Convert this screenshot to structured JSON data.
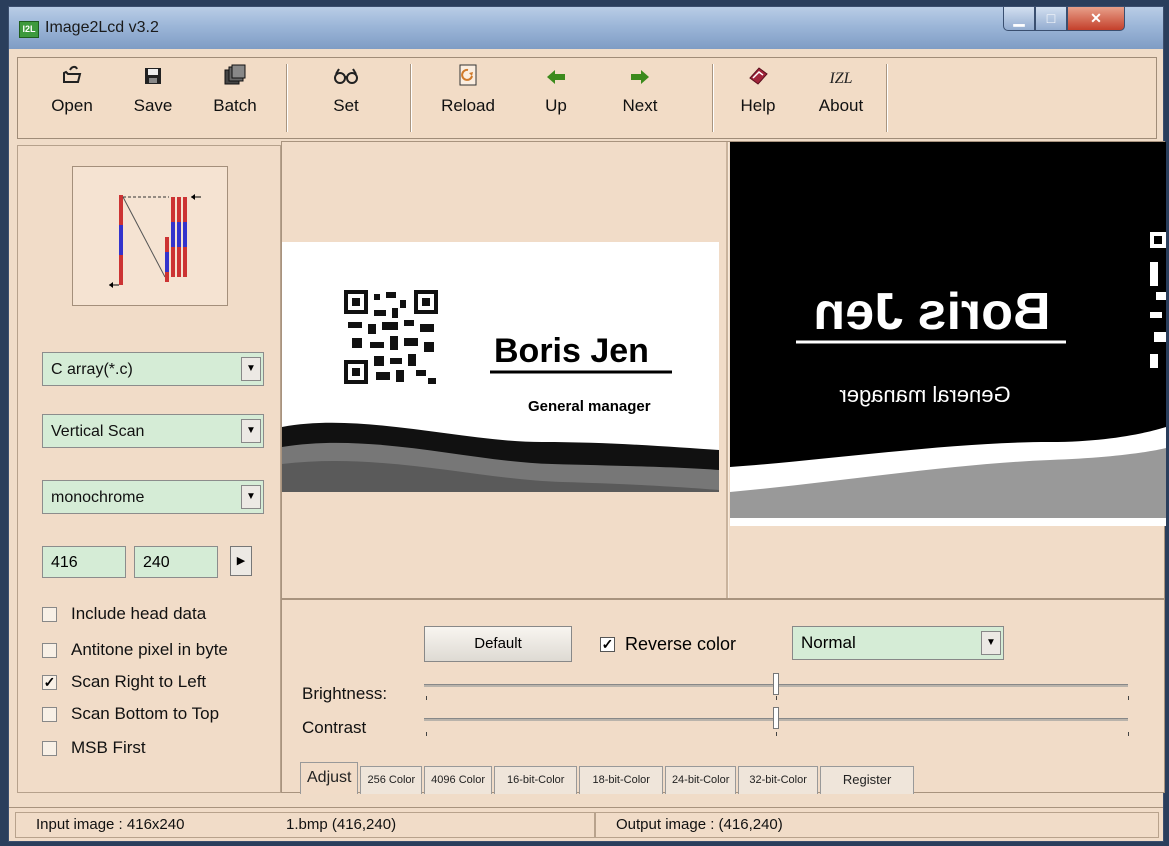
{
  "window": {
    "title": "Image2Lcd v3.2",
    "app_icon": "I2L"
  },
  "toolbar": {
    "buttons": [
      {
        "label": "Open",
        "icon": "open-icon"
      },
      {
        "label": "Save",
        "icon": "save-icon"
      },
      {
        "label": "Batch",
        "icon": "batch-icon"
      },
      {
        "label": "Set",
        "icon": "glasses-icon"
      },
      {
        "label": "Reload",
        "icon": "reload-icon"
      },
      {
        "label": "Up",
        "icon": "arrow-left-icon"
      },
      {
        "label": "Next",
        "icon": "arrow-right-icon"
      },
      {
        "label": "Help",
        "icon": "help-icon"
      },
      {
        "label": "About",
        "icon": "about-icon",
        "glyph": "IZL"
      }
    ]
  },
  "left": {
    "output_type": "C array(*.c)",
    "scan_mode": "Vertical Scan",
    "color_depth": "monochrome",
    "width": "416",
    "height": "240",
    "options": [
      {
        "label": "Include head data",
        "checked": false
      },
      {
        "label": "Antitone pixel in byte",
        "checked": false
      },
      {
        "label": "Scan Right to Left",
        "checked": true
      },
      {
        "label": "Scan Bottom to Top",
        "checked": false
      },
      {
        "label": "MSB First",
        "checked": false
      }
    ]
  },
  "preview": {
    "input_name": "Boris Jen",
    "input_title": "General manager",
    "output_name": "Boris Jen",
    "output_title": "General manager"
  },
  "settings": {
    "default_label": "Default",
    "reverse_label": "Reverse color",
    "reverse_checked": true,
    "mode": "Normal",
    "brightness_label": "Brightness:",
    "contrast_label": "Contrast",
    "brightness_value": 0.5,
    "contrast_value": 0.5,
    "tabs": [
      "Adjust",
      "256 Color",
      "4096 Color",
      "16-bit-Color",
      "18-bit-Color",
      "24-bit-Color",
      "32-bit-Color",
      "Register"
    ]
  },
  "status": {
    "input": "Input image : 416x240",
    "file": "1.bmp  (416,240)",
    "output": "Output image :  (416,240)"
  }
}
